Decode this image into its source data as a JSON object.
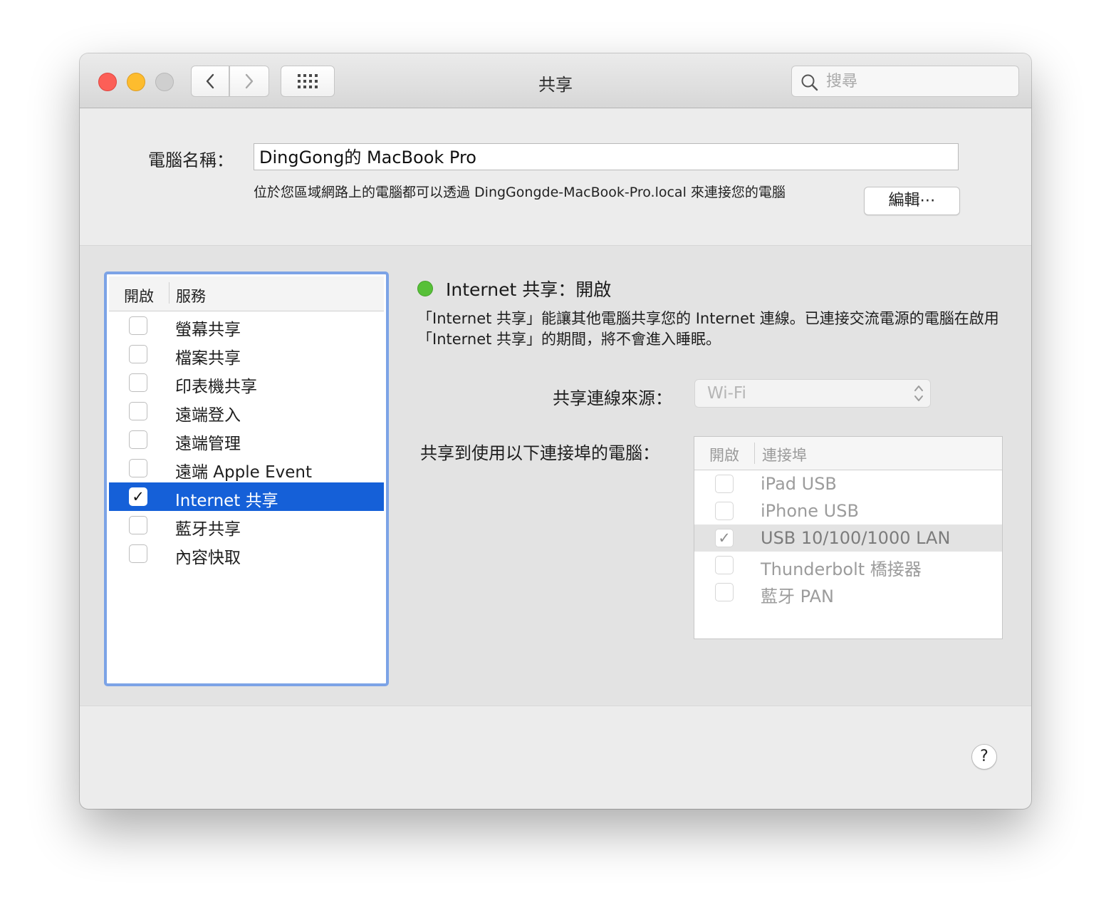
{
  "window": {
    "title": "共享"
  },
  "toolbar": {
    "back_icon": "chevron-left-icon",
    "forward_icon": "chevron-right-icon",
    "grid_icon": "grid-icon",
    "search_placeholder": "搜尋"
  },
  "computer_name": {
    "label": "電腦名稱：",
    "value": "DingGong的 MacBook Pro",
    "description": "位於您區域網路上的電腦都可以透過 DingGongde-MacBook-Pro.local 來連接您的電腦",
    "edit_label": "編輯⋯"
  },
  "services": {
    "header_on": "開啟",
    "header_service": "服務",
    "items": [
      {
        "label": "螢幕共享",
        "checked": false,
        "selected": false
      },
      {
        "label": "檔案共享",
        "checked": false,
        "selected": false
      },
      {
        "label": "印表機共享",
        "checked": false,
        "selected": false
      },
      {
        "label": "遠端登入",
        "checked": false,
        "selected": false
      },
      {
        "label": "遠端管理",
        "checked": false,
        "selected": false
      },
      {
        "label": "遠端 Apple Event",
        "checked": false,
        "selected": false
      },
      {
        "label": "Internet 共享",
        "checked": true,
        "selected": true
      },
      {
        "label": "藍牙共享",
        "checked": false,
        "selected": false
      },
      {
        "label": "內容快取",
        "checked": false,
        "selected": false
      }
    ]
  },
  "detail": {
    "status_color": "#57c038",
    "status_title": "Internet 共享：開啟",
    "description": "「Internet 共享」能讓其他電腦共享您的 Internet 連線。已連接交流電源的電腦在啟用「Internet 共享」的期間，將不會進入睡眠。",
    "source_label": "共享連線來源：",
    "source_value": "Wi-Fi",
    "ports_label": "共享到使用以下連接埠的電腦：",
    "ports_header_on": "開啟",
    "ports_header_port": "連接埠",
    "ports": [
      {
        "label": "iPad USB",
        "checked": false
      },
      {
        "label": "iPhone USB",
        "checked": false
      },
      {
        "label": "USB 10/100/1000 LAN",
        "checked": true
      },
      {
        "label": "Thunderbolt 橋接器",
        "checked": false
      },
      {
        "label": "藍牙 PAN",
        "checked": false
      }
    ]
  },
  "help": {
    "label": "?"
  }
}
